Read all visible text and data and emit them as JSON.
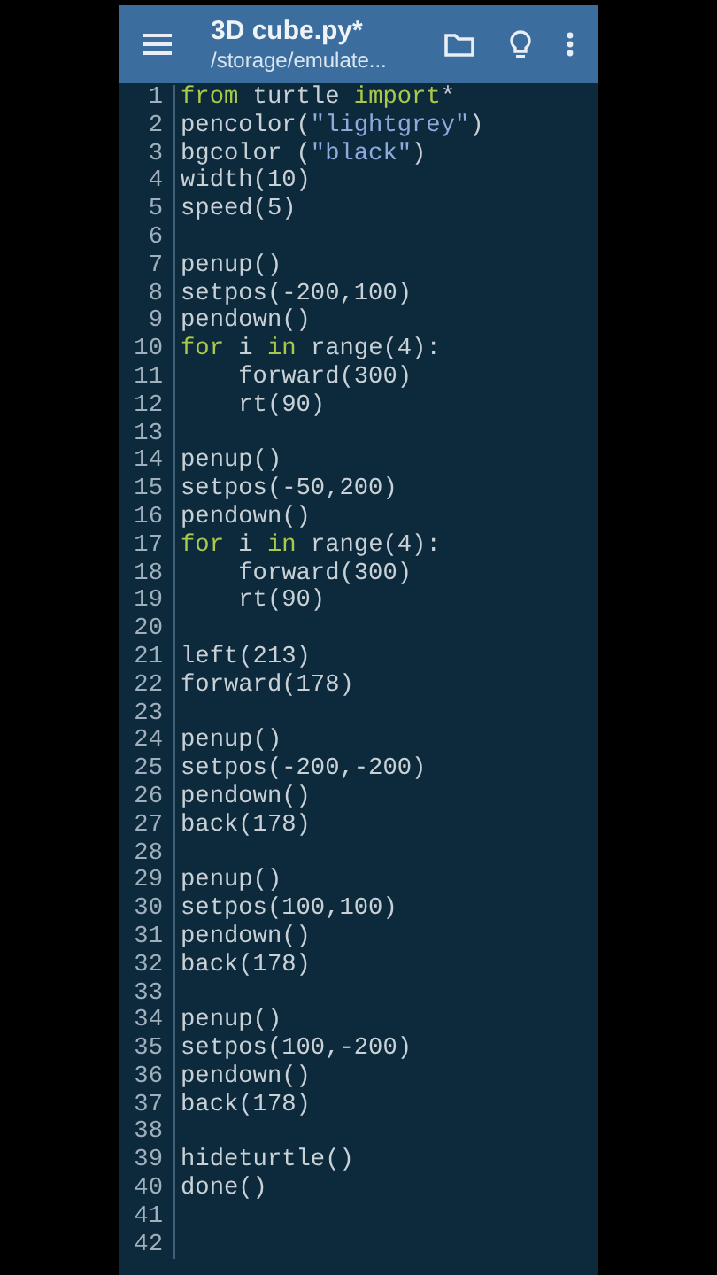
{
  "toolbar": {
    "title": "3D cube.py*",
    "subtitle": "/storage/emulate..."
  },
  "editor": {
    "lines": [
      {
        "number": "1",
        "tokens": [
          {
            "kind": "keyword",
            "text": "from"
          },
          {
            "kind": "plain",
            "text": " turtle "
          },
          {
            "kind": "keyword",
            "text": "import"
          },
          {
            "kind": "plain",
            "text": "*"
          }
        ]
      },
      {
        "number": "2",
        "tokens": [
          {
            "kind": "plain",
            "text": "pencolor("
          },
          {
            "kind": "string",
            "text": "\"lightgrey\""
          },
          {
            "kind": "plain",
            "text": ")"
          }
        ]
      },
      {
        "number": "3",
        "tokens": [
          {
            "kind": "plain",
            "text": "bgcolor ("
          },
          {
            "kind": "string",
            "text": "\"black\""
          },
          {
            "kind": "plain",
            "text": ")"
          }
        ]
      },
      {
        "number": "4",
        "tokens": [
          {
            "kind": "plain",
            "text": "width(10)"
          }
        ]
      },
      {
        "number": "5",
        "tokens": [
          {
            "kind": "plain",
            "text": "speed(5)"
          }
        ]
      },
      {
        "number": "6"
      },
      {
        "number": "7",
        "tokens": [
          {
            "kind": "plain",
            "text": "penup()"
          }
        ]
      },
      {
        "number": "8",
        "tokens": [
          {
            "kind": "plain",
            "text": "setpos(-200,100)"
          }
        ]
      },
      {
        "number": "9",
        "tokens": [
          {
            "kind": "plain",
            "text": "pendown()"
          }
        ]
      },
      {
        "number": "10",
        "tokens": [
          {
            "kind": "keyword",
            "text": "for"
          },
          {
            "kind": "plain",
            "text": " i "
          },
          {
            "kind": "keyword",
            "text": "in"
          },
          {
            "kind": "plain",
            "text": " range(4):"
          }
        ]
      },
      {
        "number": "11",
        "tokens": [
          {
            "kind": "plain",
            "text": "    forward(300)"
          }
        ]
      },
      {
        "number": "12",
        "tokens": [
          {
            "kind": "plain",
            "text": "    rt(90)"
          }
        ]
      },
      {
        "number": "13"
      },
      {
        "number": "14",
        "tokens": [
          {
            "kind": "plain",
            "text": "penup()"
          }
        ]
      },
      {
        "number": "15",
        "tokens": [
          {
            "kind": "plain",
            "text": "setpos(-50,200)"
          }
        ]
      },
      {
        "number": "16",
        "tokens": [
          {
            "kind": "plain",
            "text": "pendown()"
          }
        ]
      },
      {
        "number": "17",
        "tokens": [
          {
            "kind": "keyword",
            "text": "for"
          },
          {
            "kind": "plain",
            "text": " i "
          },
          {
            "kind": "keyword",
            "text": "in"
          },
          {
            "kind": "plain",
            "text": " range(4):"
          }
        ]
      },
      {
        "number": "18",
        "tokens": [
          {
            "kind": "plain",
            "text": "    forward(300)"
          }
        ]
      },
      {
        "number": "19",
        "tokens": [
          {
            "kind": "plain",
            "text": "    rt(90)"
          }
        ]
      },
      {
        "number": "20"
      },
      {
        "number": "21",
        "tokens": [
          {
            "kind": "plain",
            "text": "left(213)"
          }
        ]
      },
      {
        "number": "22",
        "tokens": [
          {
            "kind": "plain",
            "text": "forward(178)"
          }
        ]
      },
      {
        "number": "23"
      },
      {
        "number": "24",
        "tokens": [
          {
            "kind": "plain",
            "text": "penup()"
          }
        ]
      },
      {
        "number": "25",
        "tokens": [
          {
            "kind": "plain",
            "text": "setpos(-200,-200)"
          }
        ]
      },
      {
        "number": "26",
        "tokens": [
          {
            "kind": "plain",
            "text": "pendown()"
          }
        ]
      },
      {
        "number": "27",
        "tokens": [
          {
            "kind": "plain",
            "text": "back(178)"
          }
        ]
      },
      {
        "number": "28"
      },
      {
        "number": "29",
        "tokens": [
          {
            "kind": "plain",
            "text": "penup()"
          }
        ]
      },
      {
        "number": "30",
        "tokens": [
          {
            "kind": "plain",
            "text": "setpos(100,100)"
          }
        ]
      },
      {
        "number": "31",
        "tokens": [
          {
            "kind": "plain",
            "text": "pendown()"
          }
        ]
      },
      {
        "number": "32",
        "tokens": [
          {
            "kind": "plain",
            "text": "back(178)"
          }
        ]
      },
      {
        "number": "33"
      },
      {
        "number": "34",
        "tokens": [
          {
            "kind": "plain",
            "text": "penup()"
          }
        ]
      },
      {
        "number": "35",
        "tokens": [
          {
            "kind": "plain",
            "text": "setpos(100,-200)"
          }
        ]
      },
      {
        "number": "36",
        "tokens": [
          {
            "kind": "plain",
            "text": "pendown()"
          }
        ]
      },
      {
        "number": "37",
        "tokens": [
          {
            "kind": "plain",
            "text": "back(178)"
          }
        ]
      },
      {
        "number": "38"
      },
      {
        "number": "39",
        "tokens": [
          {
            "kind": "plain",
            "text": "hideturtle()"
          }
        ]
      },
      {
        "number": "40",
        "tokens": [
          {
            "kind": "plain",
            "text": "done()"
          }
        ]
      },
      {
        "number": "41"
      },
      {
        "number": "42"
      }
    ]
  }
}
